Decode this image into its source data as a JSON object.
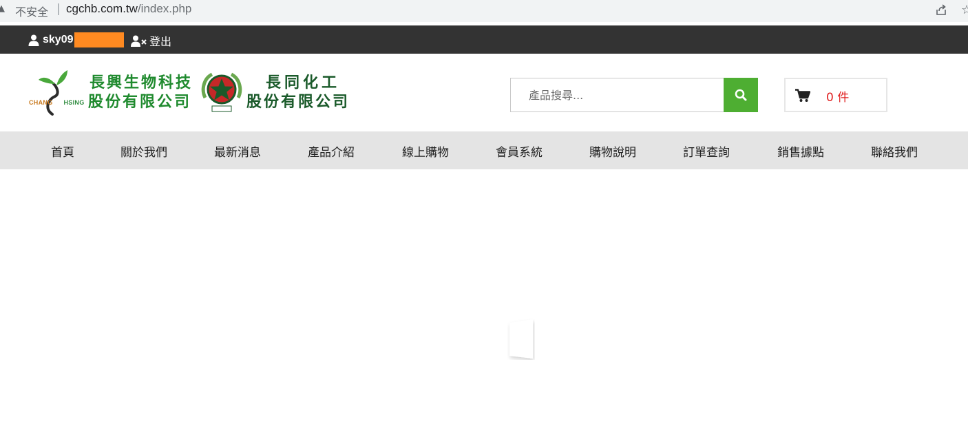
{
  "browser": {
    "security_label": "不安全",
    "separator": "|",
    "url_host": "cgchb.com.tw",
    "url_path": "/index.php"
  },
  "member_bar": {
    "username": "sky09",
    "logout_label": "登出"
  },
  "logo": {
    "en_left": "CHANG",
    "en_right": "HSING",
    "cn_line1": "長興生物科技",
    "cn_line2": "股份有限公司",
    "cn_line3": "長同化工",
    "cn_line4": "股份有限公司"
  },
  "search": {
    "placeholder": "產品搜尋..."
  },
  "cart": {
    "count_label": "0 件"
  },
  "nav": {
    "items": [
      {
        "label": "首頁"
      },
      {
        "label": "關於我們"
      },
      {
        "label": "最新消息"
      },
      {
        "label": "產品介紹"
      },
      {
        "label": "線上購物"
      },
      {
        "label": "會員系統"
      },
      {
        "label": "購物說明"
      },
      {
        "label": "訂單查詢"
      },
      {
        "label": "銷售據點"
      },
      {
        "label": "聯絡我們"
      }
    ]
  },
  "colors": {
    "member_bar_bg": "#333333",
    "nav_bg": "#e4e4e4",
    "search_btn": "#4eae32",
    "cart_count": "#e02020",
    "username_mask": "#ff8a21"
  },
  "icons": {
    "user": "user-icon",
    "logout": "user-times-icon",
    "search": "search-icon",
    "cart": "shopping-cart-icon"
  }
}
